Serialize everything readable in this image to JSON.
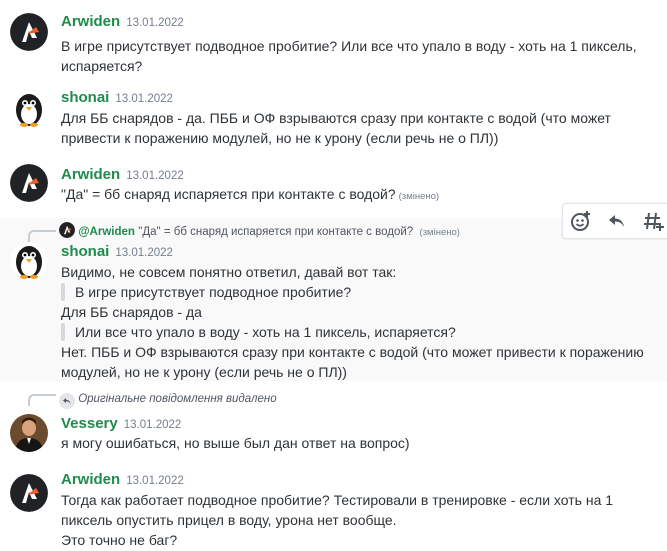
{
  "colors": {
    "author": "#1f8b4c",
    "timestamp": "#747f8d",
    "text": "#2e3338"
  },
  "messages": [
    {
      "author": "Arwiden",
      "timestamp": "13.01.2022",
      "avatar": "arwiden-logo",
      "text": "В игре присутствует подводное пробитие? Или все что упало в воду - хоть на 1 пиксель, испаряется?"
    },
    {
      "author": "shonai",
      "timestamp": "13.01.2022",
      "avatar": "penguin",
      "text": "Для ББ снарядов - да. ПББ и ОФ взрываются сразу при контакте с водой (что может привести к поражению модулей, но не к урону (если речь не о ПЛ))"
    },
    {
      "author": "Arwiden",
      "timestamp": "13.01.2022",
      "avatar": "arwiden-logo",
      "text": "\"Да\" = бб снаряд испаряется при контакте с водой?",
      "edited": "(змінено)"
    },
    {
      "reply": {
        "author": "@Arwiden",
        "text": "\"Да\" = бб снаряд испаряется при контакте с водой?",
        "edited": "(змінено)"
      },
      "author": "shonai",
      "timestamp": "13.01.2022",
      "avatar": "penguin",
      "line1": "Видимо, не совсем понятно ответил, давай вот так:",
      "quote1": "В игре присутствует подводное пробитие?",
      "line2": "Для ББ снарядов - да",
      "quote2": "Или все что упало в воду - хоть на 1 пиксель, испаряется?",
      "line3": "Нет. ПББ и ОФ взрываются сразу при контакте с водой (что может привести к поражению модулей, но не к урону (если речь не о ПЛ))"
    },
    {
      "reply": {
        "deleted": "Оригінальне повідомлення видалено"
      },
      "author": "Vessery",
      "timestamp": "13.01.2022",
      "avatar": "photo",
      "text": "я могу ошибаться, но выше был дан ответ на вопрос)"
    },
    {
      "author": "Arwiden",
      "timestamp": "13.01.2022",
      "avatar": "arwiden-logo",
      "line1": "Тогда как работает подводное пробитие? Тестировали в тренировке - если хоть на 1 пиксель опустить прицел в воду, урона нет вообще.",
      "line2": "Это точно не баг?"
    }
  ],
  "toolbar": {
    "items": [
      "add-reaction-icon",
      "reply-icon",
      "create-thread-icon"
    ]
  }
}
